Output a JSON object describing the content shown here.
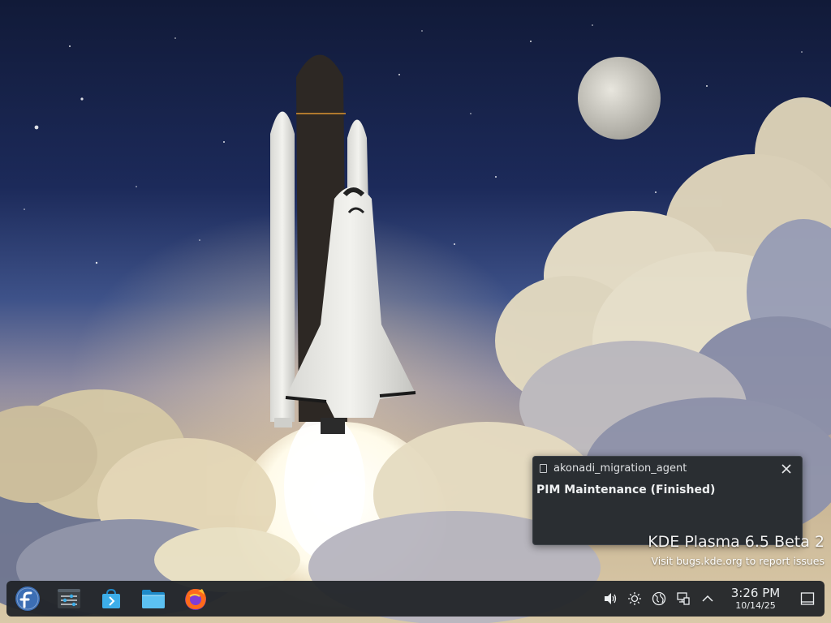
{
  "wallpaper": {
    "name": "shuttle-launch-illustration"
  },
  "notification": {
    "app_name": "akonadi_migration_agent",
    "title": "PIM Maintenance (Finished)",
    "close_icon": "close-icon",
    "app_icon": "document-icon"
  },
  "watermark": {
    "line1": "KDE Plasma 6.5 Beta 2",
    "line2": "Visit bugs.kde.org to report issues"
  },
  "panel": {
    "launcher_icon": "fedora-logo-icon",
    "tasks": [
      {
        "icon": "system-settings-icon"
      },
      {
        "icon": "discover-store-icon"
      },
      {
        "icon": "dolphin-folder-icon"
      },
      {
        "icon": "firefox-icon"
      }
    ],
    "tray": [
      {
        "icon": "volume-icon"
      },
      {
        "icon": "brightness-icon"
      },
      {
        "icon": "network-globe-icon"
      },
      {
        "icon": "network-wired-icon"
      },
      {
        "icon": "chevron-up-icon"
      }
    ],
    "clock": {
      "time": "3:26 PM",
      "date": "10/14/25"
    },
    "show_desktop_icon": "show-desktop-icon"
  },
  "colors": {
    "panel_bg": "#202327",
    "notification_bg": "#2a2e32",
    "fedora_blue": "#3c6eb4",
    "folder_blue": "#3daee9"
  }
}
